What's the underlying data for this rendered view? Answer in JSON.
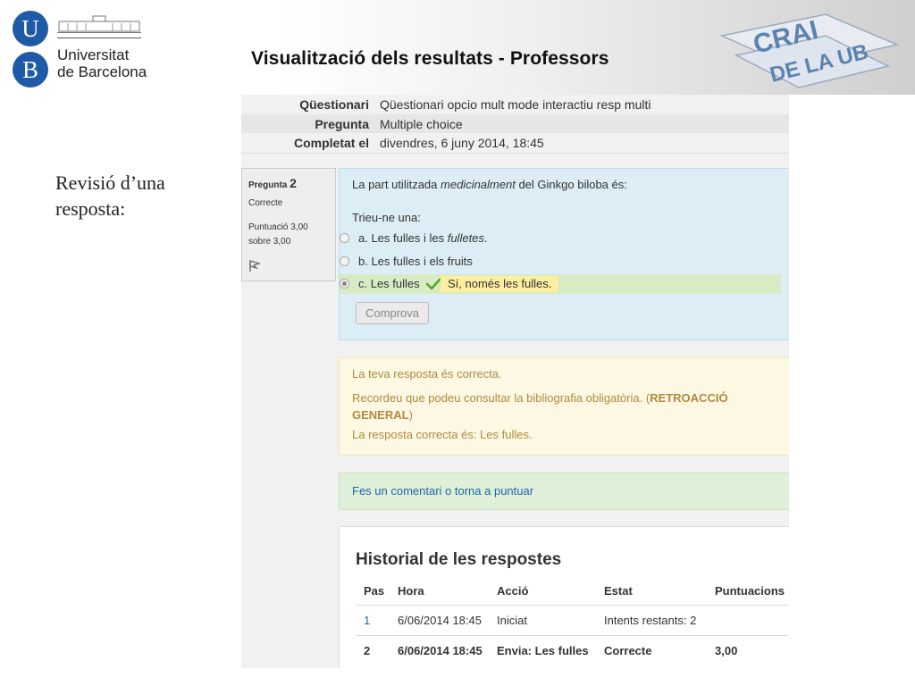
{
  "header": {
    "logo_letters": [
      "U",
      "B"
    ],
    "logo_name_line1": "Universitat",
    "logo_name_line2": "de Barcelona",
    "slide_title": "Visualització dels resultats - Professors",
    "crai_logo_text_1": "CRAI",
    "crai_logo_text_2": "DE LA UB",
    "colors": {
      "ub_blue": "#1e5aa6",
      "crai_blue": "#5b83b0"
    }
  },
  "caption": "Revisió d’una resposta:",
  "attempt_info": {
    "rows": [
      {
        "label": "Qüestionari",
        "value": "Qüestionari opcio mult mode interactiu resp multi"
      },
      {
        "label": "Pregunta",
        "value": "Multiple choice"
      },
      {
        "label": "Completat el",
        "value": "divendres, 6 juny 2014, 18:45"
      }
    ]
  },
  "question_info": {
    "label": "Pregunta",
    "number": "2",
    "state": "Correcte",
    "grade": "Puntuació 3,00 sobre 3,00",
    "flag_icon": "flag-icon"
  },
  "question": {
    "text_before": "La part utilitzada ",
    "text_em": "medicinalment",
    "text_after": " del Ginkgo biloba és:",
    "prompt": "Trieu-ne una:",
    "answers": [
      {
        "text": "a. Les fulles i les ",
        "em": "fulletes",
        "tail": ".",
        "selected": false
      },
      {
        "text": "b. Les fulles i els fruits",
        "selected": false
      },
      {
        "text": "c. Les fulles",
        "selected": true,
        "feedback": "Sí, només les fulles."
      }
    ],
    "check_button": "Comprova",
    "colors": {
      "correct_bg": "#d7ecc5",
      "feedback_bg": "#fcefa1",
      "check_green": "#5aa526"
    }
  },
  "outcome": {
    "line1": "La teva resposta és correcta.",
    "line2_before": "Recordeu que podeu consultar la bibliografia obligatòria. (",
    "line2_strong": "RETROACCIÓ GENERAL",
    "line2_after": ")",
    "line3": "La resposta correcta és: Les fulles."
  },
  "comment_link": "Fes un comentari o torna a puntuar",
  "history": {
    "title": "Historial de les respostes",
    "headers": [
      "Pas",
      "Hora",
      "Acció",
      "Estat",
      "Puntuacions"
    ],
    "rows": [
      [
        "1",
        "6/06/2014 18:45",
        "Iniciat",
        "Intents restants: 2",
        ""
      ],
      [
        "2",
        "6/06/2014 18:45",
        "Envia: Les fulles",
        "Correcte",
        "3,00"
      ]
    ]
  }
}
